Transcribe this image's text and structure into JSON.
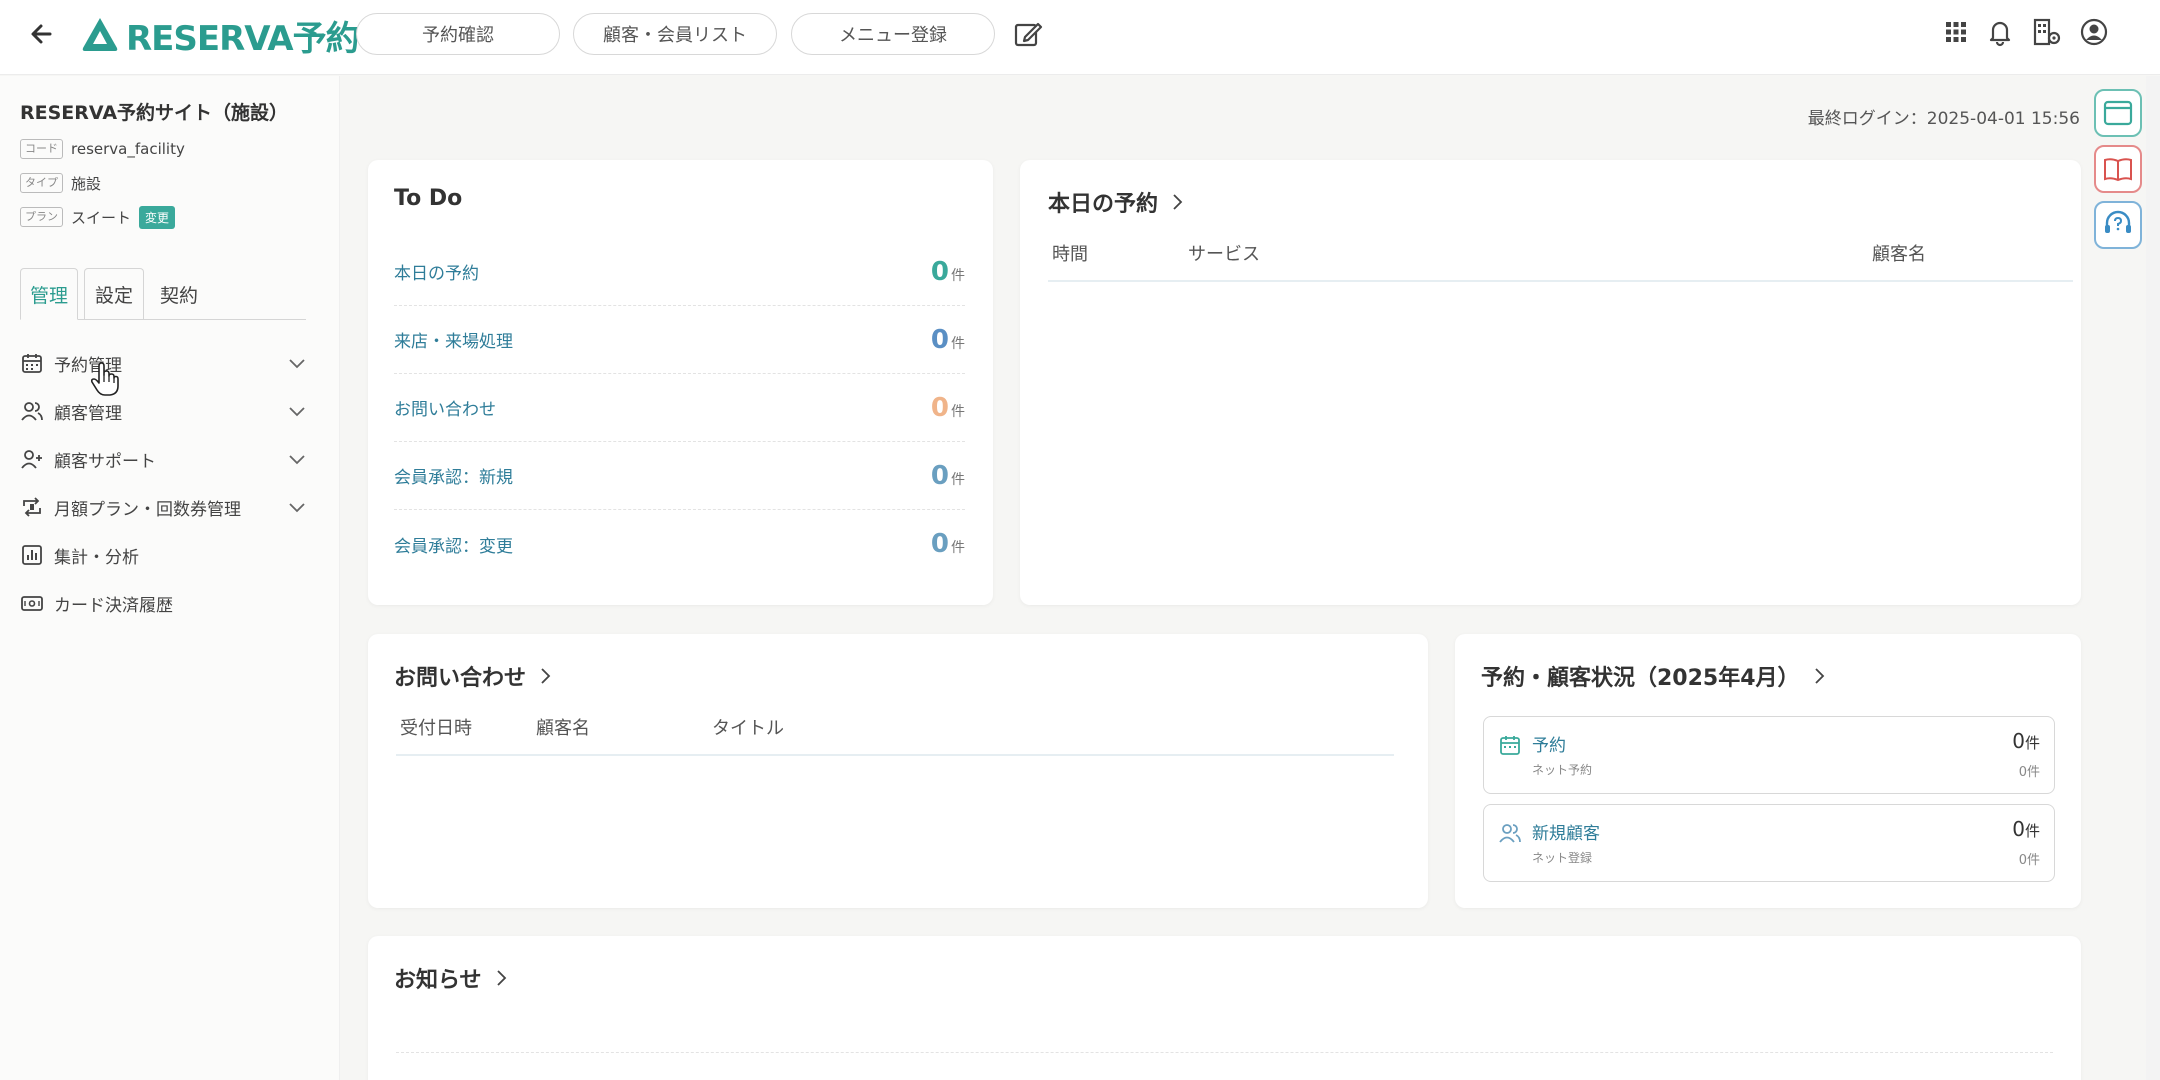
{
  "header": {
    "logo_text": "RESERVA予約",
    "nav": [
      "予約確認",
      "顧客・会員リスト",
      "メニュー登録"
    ],
    "icons": [
      "back-arrow-icon",
      "edit-icon",
      "grid-icon",
      "bell-icon",
      "building-settings-icon",
      "account-icon"
    ]
  },
  "sidebar": {
    "site_name": "RESERVA予約サイト（施設）",
    "info": [
      {
        "tag": "コード",
        "value": "reserva_facility"
      },
      {
        "tag": "タイプ",
        "value": "施設"
      },
      {
        "tag": "プラン",
        "value": "スイート",
        "badge": "変更"
      }
    ],
    "tabs": [
      "管理",
      "設定",
      "契約"
    ],
    "active_tab": "管理",
    "menu": [
      {
        "label": "予約管理",
        "icon": "calendar-icon",
        "expandable": true
      },
      {
        "label": "顧客管理",
        "icon": "users-icon",
        "expandable": true
      },
      {
        "label": "顧客サポート",
        "icon": "user-plus-icon",
        "expandable": true
      },
      {
        "label": "月額プラン・回数券管理",
        "icon": "repeat-icon",
        "expandable": true
      },
      {
        "label": "集計・分析",
        "icon": "chart-icon",
        "expandable": false
      },
      {
        "label": "カード決済履歴",
        "icon": "card-icon",
        "expandable": false
      }
    ]
  },
  "main": {
    "last_login": "最終ログイン：2025-04-01 15:56",
    "todo": {
      "title": "To Do",
      "rows": [
        {
          "label": "本日の予約",
          "count": "0",
          "unit": "件",
          "color": "#3aa99b"
        },
        {
          "label": "来店・来場処理",
          "count": "0",
          "unit": "件",
          "color": "#5a8fc4"
        },
        {
          "label": "お問い合わせ",
          "count": "0",
          "unit": "件",
          "color": "#f0b48a"
        },
        {
          "label": "会員承認：新規",
          "count": "0",
          "unit": "件",
          "color": "#6a9fc0"
        },
        {
          "label": "会員承認：変更",
          "count": "0",
          "unit": "件",
          "color": "#6a9fc0"
        }
      ]
    },
    "today": {
      "title": "本日の予約",
      "columns": [
        "時間",
        "サービス",
        "顧客名"
      ]
    },
    "inquiries": {
      "title": "お問い合わせ",
      "columns": [
        "受付日時",
        "顧客名",
        "タイトル"
      ]
    },
    "status": {
      "title": "予約・顧客状況（2025年4月）",
      "items": [
        {
          "label": "予約",
          "sub": "ネット予約",
          "count": "0",
          "unit": "件",
          "subcount": "0件",
          "icon": "calendar-icon"
        },
        {
          "label": "新規顧客",
          "sub": "ネット登録",
          "count": "0",
          "unit": "件",
          "subcount": "0件",
          "icon": "users-icon"
        }
      ]
    },
    "news": {
      "title": "お知らせ"
    }
  },
  "side_buttons": [
    "browser-window-icon",
    "manual-book-icon",
    "support-headset-icon"
  ],
  "colors": {
    "accent": "#2b9c8f",
    "link": "#2f7d99",
    "background": "#f6f6f4"
  }
}
